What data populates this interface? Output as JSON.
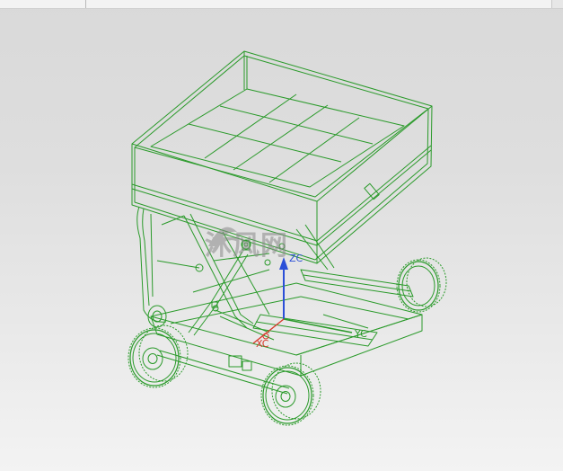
{
  "window": {
    "toolbar_present": true
  },
  "viewport": {
    "background_top": "#d9d9d9",
    "background_bottom": "#f3f3f3",
    "model_color": "#2a9a2a",
    "model_highlight": "#1f7a1f"
  },
  "watermark": {
    "text": "沐风网"
  },
  "triad": {
    "z_label": "ZC",
    "x_label": "XC",
    "y_label": "YC",
    "z_color": "#2b4fd8",
    "x_color": "#d83a2b",
    "y_color": "#2a9a2a"
  }
}
